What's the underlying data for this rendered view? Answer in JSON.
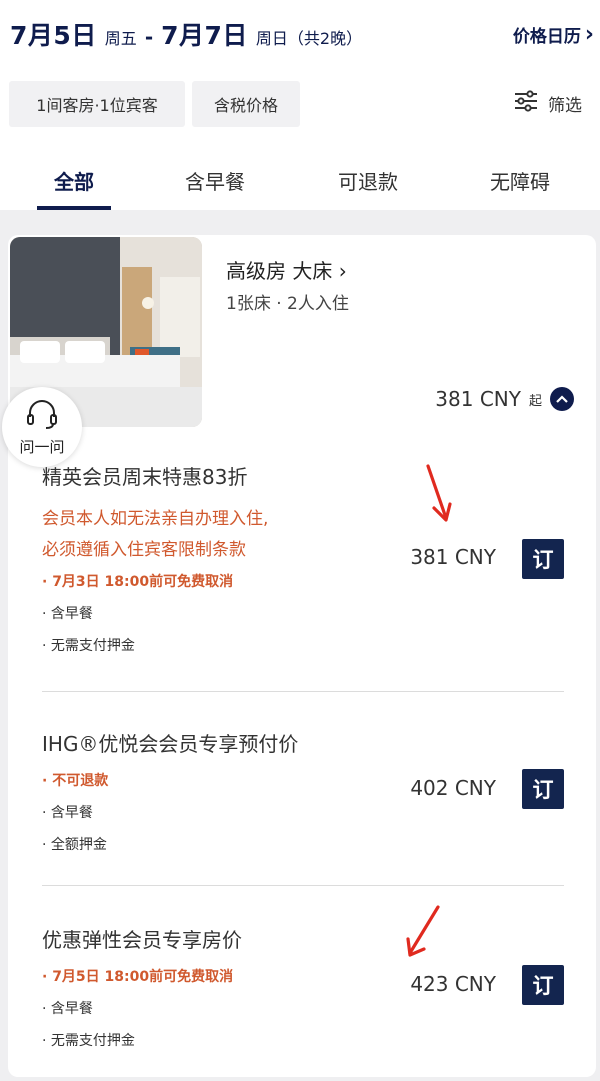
{
  "header": {
    "checkin_date": "7月5日",
    "checkin_weekday": "周五",
    "separator": "-",
    "checkout_date": "7月7日",
    "checkout_weekday": "周日（共2晚）",
    "calendar_link": "价格日历",
    "calendar_chevron": "›"
  },
  "chips": {
    "rooms_guests": "1间客房·1位宾客",
    "tax_price": "含税价格"
  },
  "filter": {
    "label": "筛选",
    "icon": "sliders-icon"
  },
  "tabs": [
    {
      "label": "全部",
      "active": true
    },
    {
      "label": "含早餐"
    },
    {
      "label": "可退款"
    },
    {
      "label": "无障碍"
    }
  ],
  "room": {
    "title": "高级房 大床 ›",
    "subtitle": "1张床 · 2人入住",
    "price": "381 CNY",
    "price_suffix": "起"
  },
  "help": {
    "label": "问一问",
    "icon": "headset-icon"
  },
  "rates": [
    {
      "name": "精英会员周末特惠83折",
      "warning_lines": [
        "会员本人如无法亲自办理入住,",
        "必须遵循入住宾客限制条款"
      ],
      "lines": [
        {
          "text": "· 7月3日 18:00前可免费取消",
          "highlight": true
        },
        {
          "text": "· 含早餐"
        },
        {
          "text": "· 无需支付押金"
        }
      ],
      "price": "381 CNY",
      "book_label": "订"
    },
    {
      "name": "IHG®优悦会会员专享预付价",
      "lines": [
        {
          "text": "· 不可退款",
          "highlight": true
        },
        {
          "text": "· 含早餐"
        },
        {
          "text": "· 全额押金"
        }
      ],
      "price": "402 CNY",
      "book_label": "订"
    },
    {
      "name": "优惠弹性会员专享房价",
      "lines": [
        {
          "text": "· 7月5日 18:00前可免费取消",
          "highlight": true
        },
        {
          "text": "· 含早餐"
        },
        {
          "text": "· 无需支付押金"
        }
      ],
      "price": "423 CNY",
      "book_label": "订"
    }
  ],
  "colors": {
    "brand_navy": "#0f1c4d",
    "warning_orange": "#d0592e",
    "annotation_red": "#e02a1f"
  }
}
